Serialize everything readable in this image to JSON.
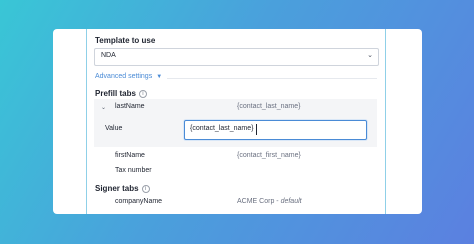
{
  "template": {
    "label": "Template to use",
    "value": "NDA"
  },
  "advanced": {
    "label": "Advanced settings"
  },
  "prefill": {
    "label": "Prefill tabs",
    "expanded": {
      "name": "lastName",
      "var": "{contact_last_name}",
      "value_label": "Value",
      "value": "{contact_last_name}"
    },
    "rows": [
      {
        "name": "firstName",
        "var": "{contact_first_name}"
      },
      {
        "name": "Tax number",
        "var": ""
      }
    ]
  },
  "signer": {
    "label": "Signer tabs",
    "rows": [
      {
        "name": "companyName",
        "value": "ACME Corp",
        "sep": " - ",
        "default": "default"
      }
    ]
  },
  "icons": {
    "info": "info-icon",
    "chevron": "chevron-down-icon"
  },
  "colors": {
    "accent": "#4a8bd6",
    "bg_start": "#39c6d6",
    "bg_end": "#5b80e0"
  }
}
